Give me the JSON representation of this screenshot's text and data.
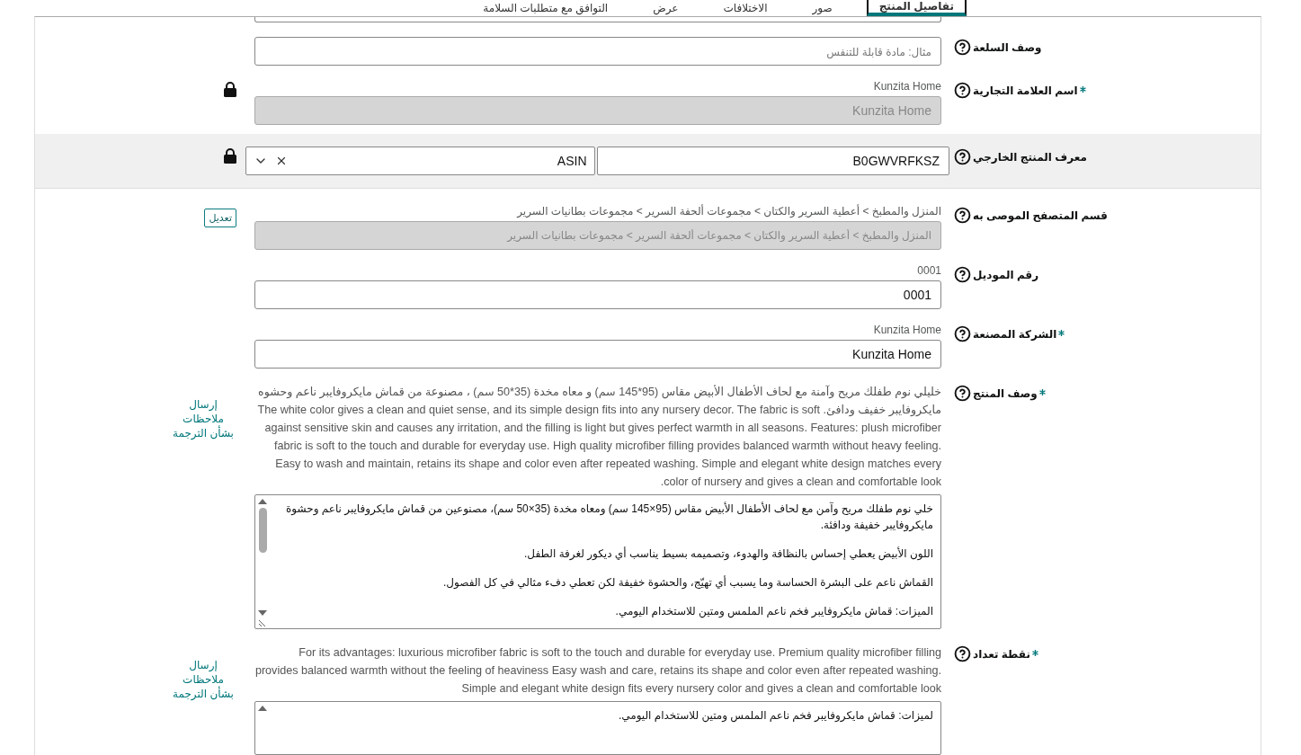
{
  "tabs": [
    {
      "label": "تفاصيل المنتج",
      "selected": true
    },
    {
      "label": "صور",
      "selected": false
    },
    {
      "label": "الاختلافات",
      "selected": false
    },
    {
      "label": "عرض",
      "selected": false
    },
    {
      "label": "التوافق مع متطلبات السلامة",
      "selected": false
    }
  ],
  "fields": [
    {
      "kind": "input",
      "label": "وصف السلعة",
      "required": false,
      "placeholder": "مثال: مادة قابلة للتنفس",
      "disabled": false,
      "locked": false
    },
    {
      "kind": "input",
      "label": "اسم العلامة التجارية",
      "required": true,
      "caption": "Kunzita Home",
      "value": "Kunzita Home",
      "disabled": true,
      "locked": true
    },
    {
      "kind": "id",
      "label": "معرف المنتج الخارجي",
      "required": false,
      "value": "B0GWVRFKSZ",
      "id_type": "ASIN",
      "locked": true
    },
    {
      "kind": "input",
      "label": "قسم المتصفح الموصى به",
      "required": false,
      "caption": "المنزل والمطبخ > أعطية السرير والكتان > مجموعات ألحفة السرير > مجموعات بطانيات السرير",
      "value": "المنزل والمطبخ > أعطية السرير والكتان > مجموعات ألحفة السرير > مجموعات بطانيات السرير",
      "disabled": true,
      "locked": false,
      "edit_button": "تعديل"
    },
    {
      "kind": "input",
      "label": "رقم الموديل",
      "required": false,
      "caption": "0001",
      "value": "0001",
      "disabled": false,
      "locked": false
    },
    {
      "kind": "input",
      "label": "الشركة المصنعة",
      "required": true,
      "caption": "Kunzita Home",
      "value": "Kunzita Home",
      "disabled": false,
      "locked": false
    },
    {
      "kind": "textarea",
      "label": "وصف المنتج",
      "required": true,
      "note_link": "إرسال ملاحظات بشأن الترجمة",
      "source": "خليلي نوم طفلك مريح وآمنة مع لحاف الأطفال الأبيض مقاس (95*145 سم) و معاه مخدة (35*50 سم) ، مصنوعة من قماش مايكروفايبر ناعم وحشوه مايكروفايبر خفيف ودافئ. The white color gives a clean and quiet sense, and its simple design fits into any nursery decor. The fabric is soft against sensitive skin and causes any irritation, and the filling is light but gives perfect warmth in all seasons. Features: plush microfiber fabric is soft to the touch and durable for everyday use. High quality microfiber filling provides balanced warmth without heavy feeling. Easy to wash and maintain, retains its shape and color even after repeated washing. Simple and elegant white design matches every color of nursery and gives a clean and comfortable look.",
      "paragraphs": [
        "خلي نوم طفلك مريح وآمن مع لحاف الأطفال الأبيض مقاس (95×145 سم) ومعاه مخدة (35×50 سم)، مصنوعين من قماش مايكروفايبر ناعم وحشوة مايكروفايبر خفيفة ودافئة.",
        "اللون الأبيض يعطي إحساس بالنظافة والهدوء، وتصميمه بسيط يناسب أي ديكور لغرفة الطفل.",
        "القماش ناعم على البشرة الحساسة وما يسبب أي تهيّج، والحشوة خفيفة لكن تعطي دفء مثالي في كل الفصول.",
        "الميزات: قماش مايكروفايبر فخم ناعم الملمس ومتين للاستخدام اليومي."
      ]
    },
    {
      "kind": "textarea",
      "label": "نقطة تعداد",
      "required": true,
      "note_link": "إرسال ملاحظات بشأن الترجمة",
      "source": "For its advantages: luxurious microfiber fabric is soft to the touch and durable for everyday use. Premium quality microfiber filling provides balanced warmth without the feeling of heaviness Easy wash and care, retains its shape and color even after repeated washing. Simple and elegant white design fits every nursery color and gives a clean and comfortable look",
      "paragraphs": [
        "لميزات: قماش مايكروفايبر فخم ناعم الملمس ومتين للاستخدام اليومي."
      ]
    }
  ]
}
